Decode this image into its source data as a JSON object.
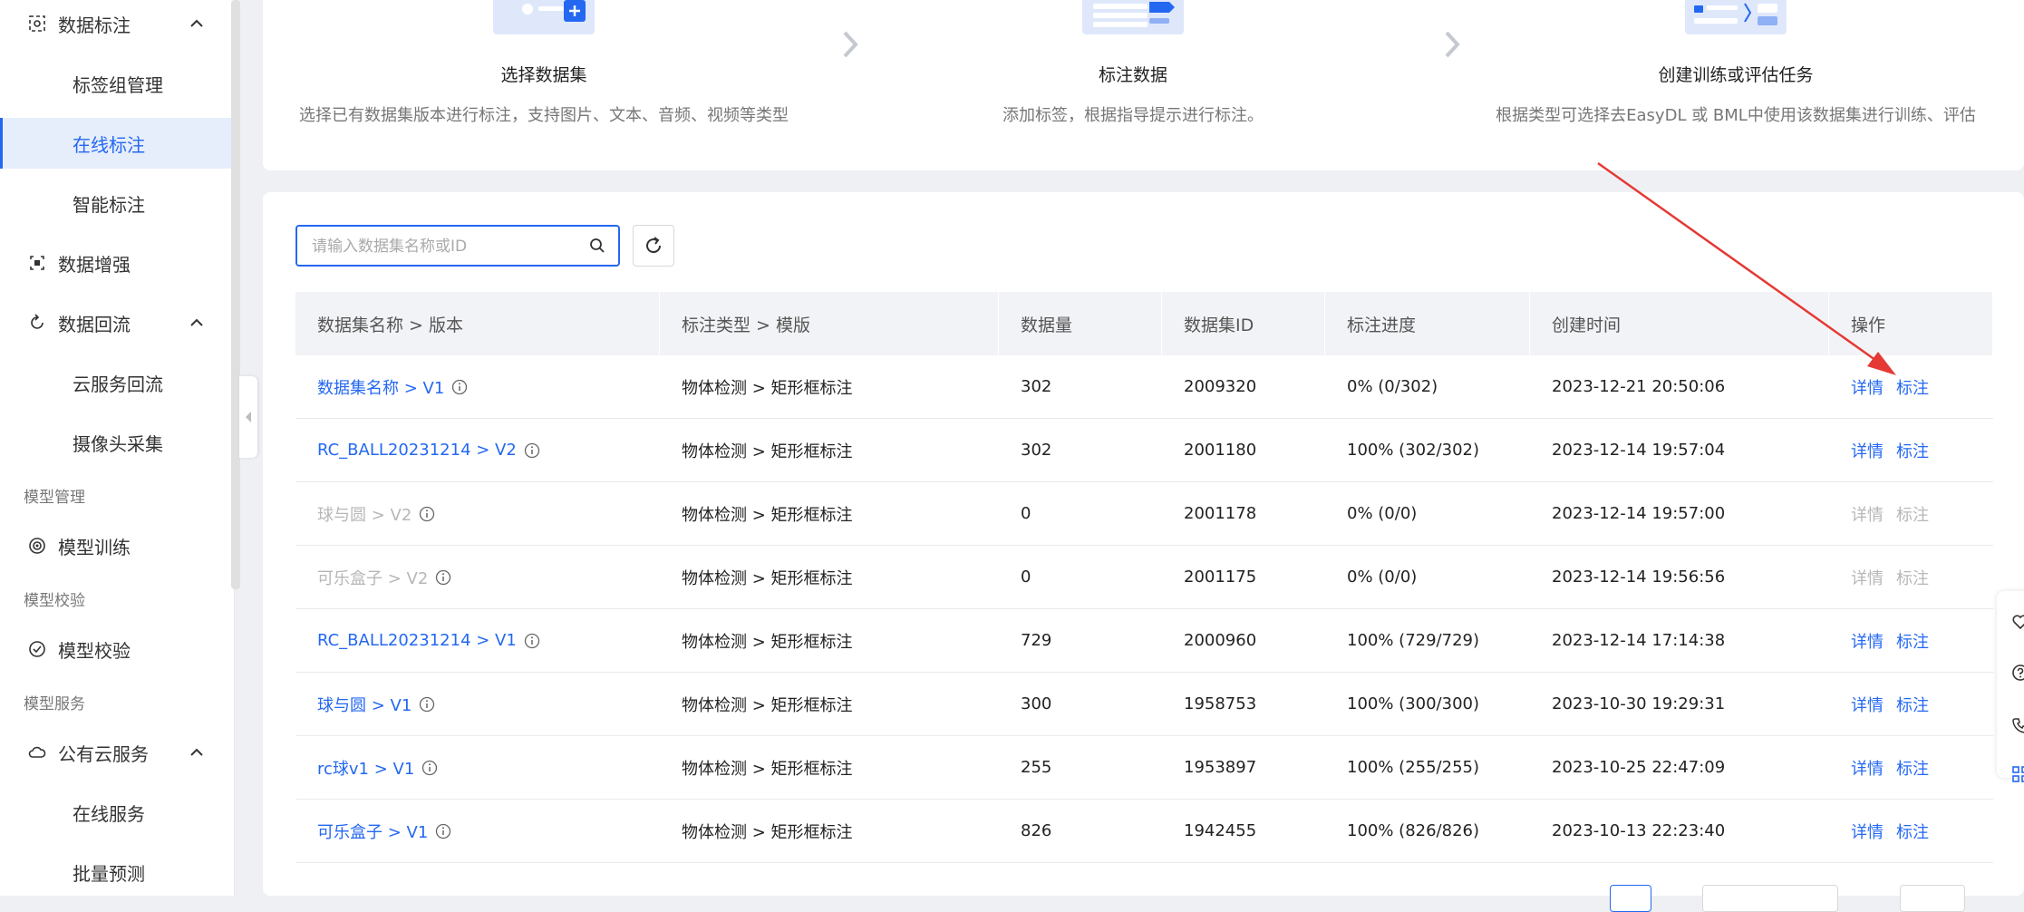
{
  "sidebar": {
    "data_annotation": "数据标注",
    "label_group_mgmt": "标签组管理",
    "online_annotation": "在线标注",
    "smart_annotation": "智能标注",
    "data_augmentation": "数据增强",
    "data_backflow": "数据回流",
    "cloud_service_backflow": "云服务回流",
    "camera_capture": "摄像头采集",
    "group_model_mgmt": "模型管理",
    "model_training": "模型训练",
    "group_model_validation": "模型校验",
    "model_validation": "模型校验",
    "group_model_service": "模型服务",
    "public_cloud_service": "公有云服务",
    "online_service": "在线服务",
    "batch_predict": "批量预测"
  },
  "steps": [
    {
      "title": "选择数据集",
      "desc": "选择已有数据集版本进行标注，支持图片、文本、音频、视频等类型"
    },
    {
      "title": "标注数据",
      "desc": "添加标签，根据指导提示进行标注。"
    },
    {
      "title": "创建训练或评估任务",
      "desc": "根据类型可选择去EasyDL 或 BML中使用该数据集进行训练、评估"
    }
  ],
  "search": {
    "placeholder": "请输入数据集名称或ID"
  },
  "table": {
    "headers": [
      "数据集名称 > 版本",
      "标注类型 > 模版",
      "数据量",
      "数据集ID",
      "标注进度",
      "创建时间",
      "操作"
    ],
    "op_detail": "详情",
    "op_annotate": "标注",
    "rows": [
      {
        "name": "数据集名称 > V1",
        "type": "物体检测 > 矩形框标注",
        "count": "302",
        "id": "2009320",
        "progress": "0% (0/302)",
        "created": "2023-12-21 20:50:06"
      },
      {
        "name": "RC_BALL20231214 > V2",
        "type": "物体检测 > 矩形框标注",
        "count": "302",
        "id": "2001180",
        "progress": "100% (302/302)",
        "created": "2023-12-14 19:57:04"
      },
      {
        "name": "球与圆 > V2",
        "type": "物体检测 > 矩形框标注",
        "count": "0",
        "id": "2001178",
        "progress": "0% (0/0)",
        "created": "2023-12-14 19:57:00"
      },
      {
        "name": "可乐盒子 > V2",
        "type": "物体检测 > 矩形框标注",
        "count": "0",
        "id": "2001175",
        "progress": "0% (0/0)",
        "created": "2023-12-14 19:56:56"
      },
      {
        "name": "RC_BALL20231214 > V1",
        "type": "物体检测 > 矩形框标注",
        "count": "729",
        "id": "2000960",
        "progress": "100% (729/729)",
        "created": "2023-12-14 17:14:38"
      },
      {
        "name": "球与圆 > V1",
        "type": "物体检测 > 矩形框标注",
        "count": "300",
        "id": "1958753",
        "progress": "100% (300/300)",
        "created": "2023-10-30 19:29:31"
      },
      {
        "name": "rc球v1 > V1",
        "type": "物体检测 > 矩形框标注",
        "count": "255",
        "id": "1953897",
        "progress": "100% (255/255)",
        "created": "2023-10-25 22:47:09"
      },
      {
        "name": "可乐盒子 > V1",
        "type": "物体检测 > 矩形框标注",
        "count": "826",
        "id": "1942455",
        "progress": "100% (826/826)",
        "created": "2023-10-13 22:23:40"
      }
    ]
  },
  "colors": {
    "accent": "#2468f2",
    "disabled": "#b7b7b7",
    "annotation_arrow": "#e53935"
  }
}
